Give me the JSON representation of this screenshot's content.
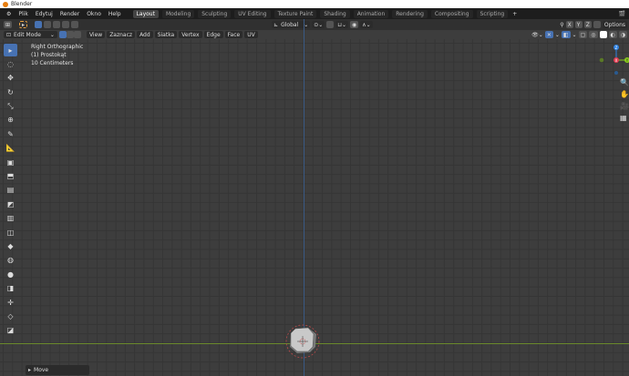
{
  "window": {
    "title": "Blender"
  },
  "menu": [
    "Plik",
    "Edytuj",
    "Render",
    "Okno",
    "Help"
  ],
  "workspaces": [
    "Layout",
    "Modeling",
    "Sculpting",
    "UV Editing",
    "Texture Paint",
    "Shading",
    "Animation",
    "Rendering",
    "Compositing",
    "Scripting"
  ],
  "header": {
    "orientation": "Global",
    "axes": [
      "X",
      "Y",
      "Z"
    ],
    "options": "Options"
  },
  "editor": {
    "mode": "Edit Mode",
    "menus": [
      "View",
      "Zaznacz",
      "Add",
      "Siatka",
      "Vertex",
      "Edge",
      "Face",
      "UV"
    ]
  },
  "viewport": {
    "view_name": "Right Orthographic",
    "object": "(1) Prostokąt",
    "scale": "10 Centimeters"
  },
  "gizmo": {
    "z": "Z",
    "x": "X",
    "y": "Y"
  },
  "operator_panel": {
    "label": "Move"
  },
  "colors": {
    "accent": "#4772b3",
    "x_axis": "#e23c52",
    "y_axis": "#8acd1c",
    "z_axis": "#2f83e3"
  }
}
